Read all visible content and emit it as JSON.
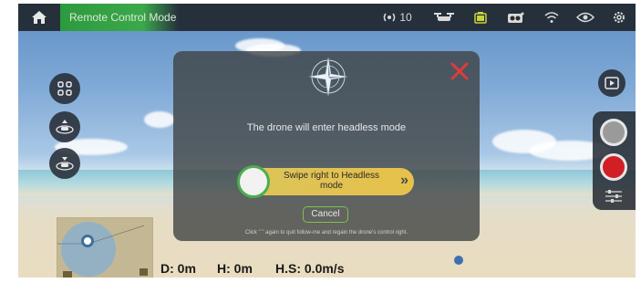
{
  "topbar": {
    "mode_label": "Remote Control Mode",
    "signal_value": "10",
    "icons": [
      "home-icon",
      "signal-strength-icon",
      "drone-icon",
      "battery-icon",
      "camera-icon",
      "wifi-icon",
      "eye-icon",
      "settings-gear-icon"
    ]
  },
  "left_controls": [
    "grid-menu-icon",
    "drone-takeoff-icon",
    "drone-land-icon"
  ],
  "right_controls": [
    "playback-icon",
    "photo-shutter-icon",
    "record-video-icon",
    "adjust-sliders-icon"
  ],
  "dialog": {
    "message": "The drone will enter headless mode",
    "swipe_label": "Swipe right to Headless mode",
    "swipe_arrows": "»",
    "cancel_label": "Cancel",
    "hint": "Click \" \" again to quit follow-me and regain the drone's control right."
  },
  "telemetry": {
    "distance": "D: 0m",
    "height": "H: 0m",
    "speed": "H.S: 0.0m/s"
  },
  "colors": {
    "accent_green": "#3aa84b",
    "close_red": "#e03b3b",
    "swipe_yellow": "#e6c24a"
  }
}
